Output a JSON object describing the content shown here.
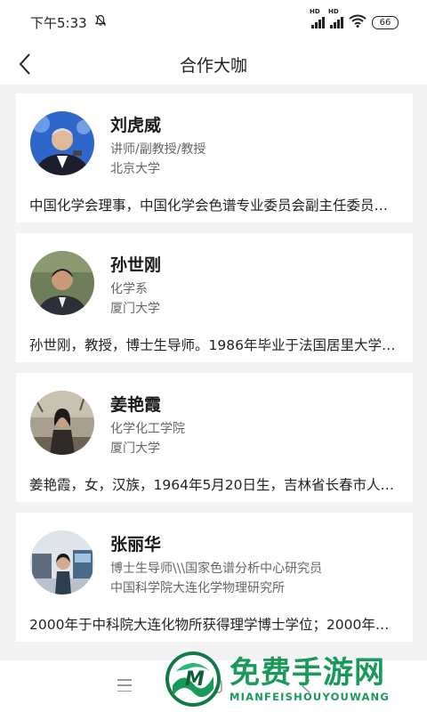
{
  "status_bar": {
    "time": "下午5:33",
    "network_label": "HD",
    "battery": "66"
  },
  "nav": {
    "title": "合作大咖"
  },
  "experts": [
    {
      "name": "刘虎威",
      "title": "讲师/副教授/教授",
      "org": "北京大学",
      "desc": "中国化学会理事，中国化学会色谱专业委员会副主任委员……"
    },
    {
      "name": "孙世刚",
      "title": "化学系",
      "org": "厦门大学",
      "desc": "孙世刚，教授，博士生导师。1986年毕业于法国居里大学……"
    },
    {
      "name": "姜艳霞",
      "title": "化学化工学院",
      "org": "厦门大学",
      "desc": "姜艳霞，女，汉族，1964年5月20日生，吉林省长春市人……"
    },
    {
      "name": "张丽华",
      "title": "博士生导师\\\\\\国家色谱分析中心研究员",
      "org": "中国科学院大连化学物理研究所",
      "desc": "2000年于中科院大连化物所获得理学博士学位；2000年……"
    }
  ],
  "watermark": {
    "cn": "免费手游网",
    "en": "MIANFEISHOUYOUWANG"
  },
  "colors": {
    "accent_green": "#1a9a5a",
    "background": "#f3f3f3"
  }
}
